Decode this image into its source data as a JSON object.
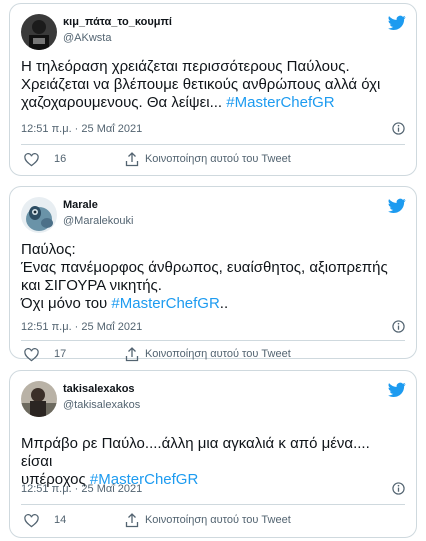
{
  "colors": {
    "accent": "#1d9bf0",
    "text": "#0f1419",
    "muted": "#536471",
    "border": "#cfd9de"
  },
  "tweets": [
    {
      "name": "κιμ_πάτα_το_κουμπί",
      "handle": "@AKwsta",
      "text_lines": [
        "Η τηλεόραση χρειάζεται περισσότερους Παύλους.",
        "Χρειάζεται να βλέπουμε θετικούς ανθρώπους αλλά όχι",
        "χαζοχαρουμενους. Θα λείψει... "
      ],
      "hashtag": "#MasterChefGR",
      "time": "12:51 π.μ. · 25 Μαΐ 2021",
      "likes": "16",
      "share_label": "Κοινοποίηση αυτού του Tweet"
    },
    {
      "name": "Marale",
      "handle": "@Maralekouki",
      "text_lines": [
        "Παύλος:",
        "Ένας πανέμορφος άνθρωπος, ευαίσθητος, αξιοπρεπής",
        "και ΣΙΓΟΥΡΑ νικητής.",
        "Όχι μόνο του "
      ],
      "hashtag": "#MasterChefGR",
      "hashtag_suffix": "..",
      "time": "12:51 π.μ. · 25 Μαΐ 2021",
      "likes": "17",
      "share_label": "Κοινοποίηση αυτού του Tweet"
    },
    {
      "name": "takisalexakos",
      "handle": "@takisalexakos",
      "text_lines": [
        "Μπράβο ρε Παύλο....άλλη μια αγκαλιά κ από μένα.... είσαι",
        "υπέροχος "
      ],
      "hashtag": "#MasterChefGR",
      "time": "12:51 π.μ. · 25 Μαΐ 2021",
      "likes": "14",
      "share_label": "Κοινοποίηση αυτού του Tweet"
    }
  ]
}
